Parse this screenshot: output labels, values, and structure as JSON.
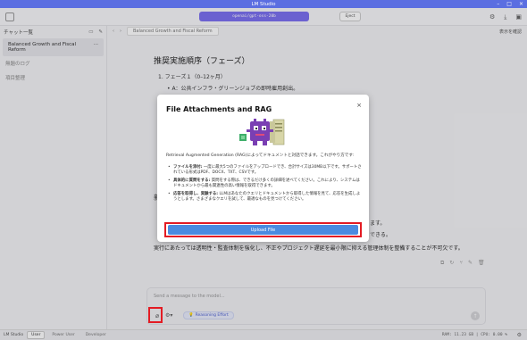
{
  "window": {
    "title": "LM Studio"
  },
  "toolbar": {
    "model": "openai/gpt-oss-20b",
    "eject": "Eject"
  },
  "sidebar": {
    "header": "チャット一覧",
    "items": [
      {
        "label": "Balanced Growth and Fiscal Reform",
        "active": true
      },
      {
        "label": "無題のログ",
        "active": false
      },
      {
        "label": "項目整理",
        "active": false
      }
    ]
  },
  "tab": {
    "label": "Balanced Growth and Fiscal Reform"
  },
  "show_settings": "表示を確認",
  "chat": {
    "heading": "推奨実施順序（フェーズ）",
    "phase1": "1. フェーズ１（0–12ヶ月）",
    "phase1_sub": "• A：公共インフラ・グリーンジョブの即時雇用創出。",
    "frag_left": "新",
    "frag_right1": "ます。",
    "frag_right2": "できる。",
    "bottom": "実行にあたっては透明性・監査体制を強化し、不正やプロジェクト遅延を最小限に抑える管理体制を整備することが不可欠です。"
  },
  "modal": {
    "title": "File Attachments and RAG",
    "description": "Retrieval Augmented Generation (RAG)によってドキュメントと対話できます。これがやり方です:",
    "bullets": [
      {
        "head": "ファイルを添付:",
        "text": "一度に最大5つのファイルをアップロードでき、合計サイズは30MB以下です。サポートされている形式はPDF、DOCX、TXT、CSVです。"
      },
      {
        "head": "具体的に質問をする:",
        "text": "質問をする際は、できるだけ多くの詳細を述べてください。これにより、システムはドキュメントから最も関連性の高い情報を取得できます。"
      },
      {
        "head": "応答を取得し、実験する:",
        "text": "LLMはあなたのクエリとドキュメントから取得した情報を見て、応答を生成しようとします。さまざまなクエリを試して、最適なものを見つけてください。"
      }
    ],
    "upload_label": "Upload File"
  },
  "composer": {
    "placeholder": "Send a message to the model...",
    "reasoning": "Reasoning Effort"
  },
  "statusbar": {
    "app": "LM Studio",
    "modes": [
      "User",
      "Power User",
      "Developer"
    ],
    "sysinfo": "RAM: 11.23 GB | CPU: 0.00 %"
  }
}
